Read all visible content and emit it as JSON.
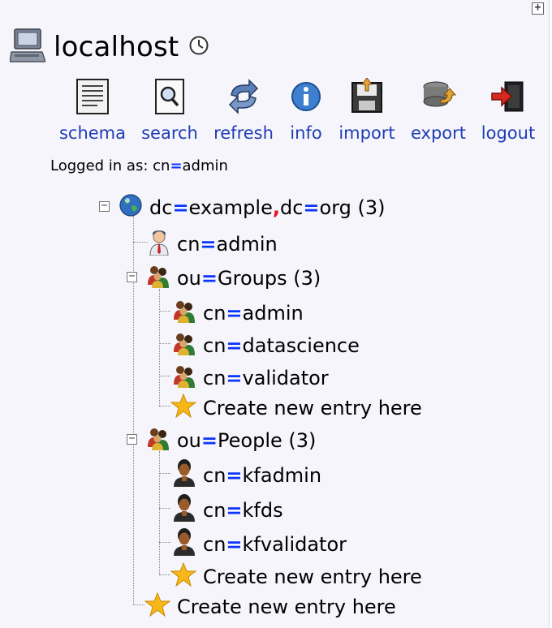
{
  "server": {
    "name": "localhost"
  },
  "toolbar": [
    {
      "id": "schema",
      "label": "schema",
      "icon": "schema-icon"
    },
    {
      "id": "search",
      "label": "search",
      "icon": "search-icon"
    },
    {
      "id": "refresh",
      "label": "refresh",
      "icon": "refresh-icon"
    },
    {
      "id": "info",
      "label": "info",
      "icon": "info-icon"
    },
    {
      "id": "import",
      "label": "import",
      "icon": "import-icon"
    },
    {
      "id": "export",
      "label": "export",
      "icon": "export-icon"
    },
    {
      "id": "logout",
      "label": "logout",
      "icon": "logout-icon"
    }
  ],
  "login": {
    "prefix": "Logged in as: ",
    "attr": "cn",
    "value": "admin"
  },
  "tree": {
    "root": {
      "dn1_attr": "dc",
      "dn1_val": "example",
      "dn2_attr": "dc",
      "dn2_val": "org",
      "count": "(3)"
    },
    "items": [
      {
        "attr": "cn",
        "val": "admin"
      },
      {
        "attr": "ou",
        "val": "Groups",
        "count": "(3)"
      },
      {
        "attr": "cn",
        "val": "admin"
      },
      {
        "attr": "cn",
        "val": "datascience"
      },
      {
        "attr": "cn",
        "val": "validator"
      },
      {
        "attr": "ou",
        "val": "People",
        "count": "(3)"
      },
      {
        "attr": "cn",
        "val": "kfadmin"
      },
      {
        "attr": "cn",
        "val": "kfds"
      },
      {
        "attr": "cn",
        "val": "kfvalidator"
      }
    ],
    "create_label": "Create new entry here"
  },
  "colors": {
    "link": "#1f3db6",
    "equals": "#0b34ff",
    "comma": "#e4141a"
  }
}
